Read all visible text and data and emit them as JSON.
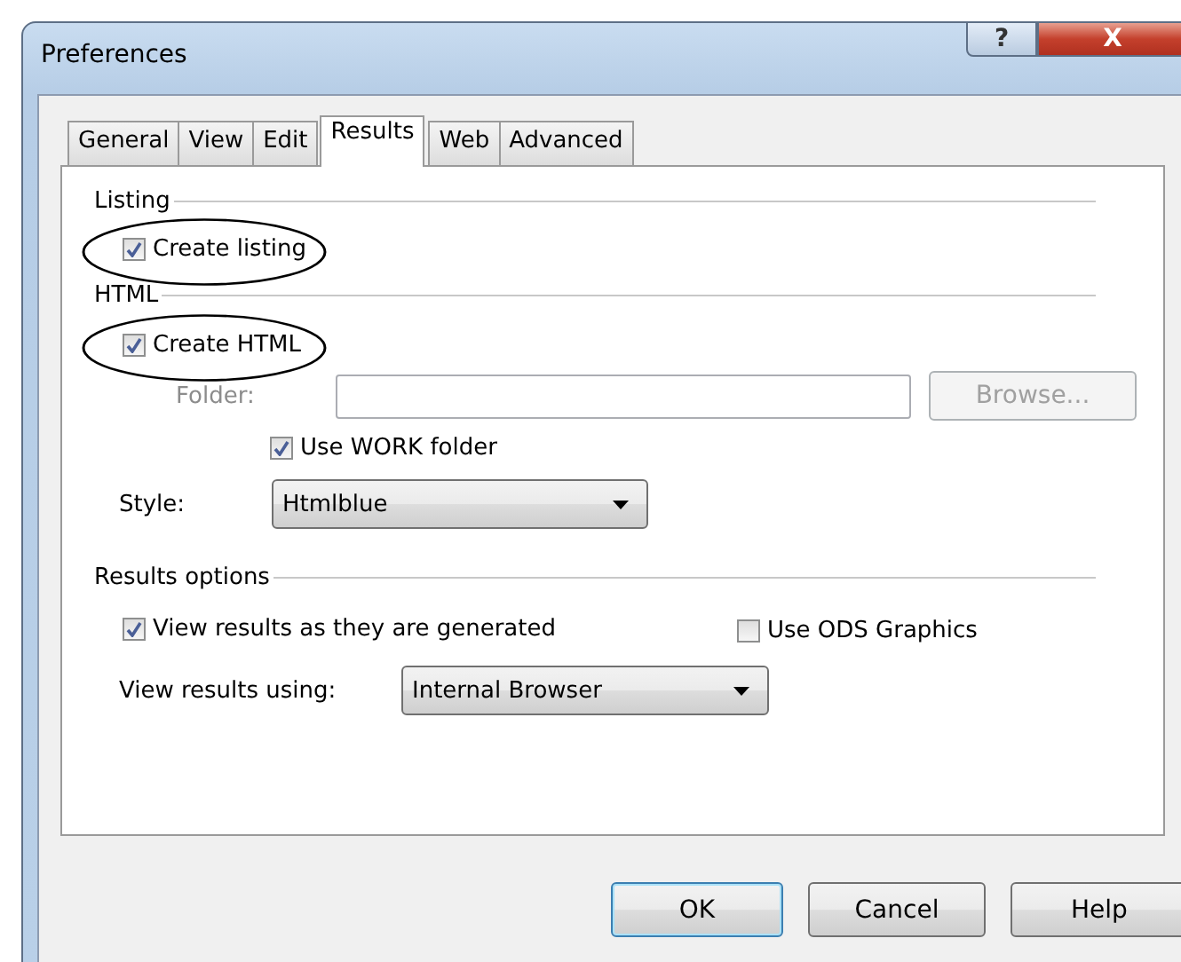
{
  "window": {
    "title": "Preferences",
    "help_button": "?",
    "close_button": "X"
  },
  "tabs": [
    {
      "label": "General",
      "selected": false
    },
    {
      "label": "View",
      "selected": false
    },
    {
      "label": "Edit",
      "selected": false
    },
    {
      "label": "Results",
      "selected": true
    },
    {
      "label": "Web",
      "selected": false
    },
    {
      "label": "Advanced",
      "selected": false
    }
  ],
  "listing": {
    "heading": "Listing",
    "create_listing": {
      "label": "Create listing",
      "checked": true,
      "circled": true
    }
  },
  "html": {
    "heading": "HTML",
    "create_html": {
      "label": "Create HTML",
      "checked": true,
      "circled": true
    },
    "folder": {
      "label": "Folder:",
      "disabled": true
    },
    "browse_button": {
      "label": "Browse...",
      "disabled": true
    },
    "use_work_folder": {
      "label": "Use WORK folder",
      "checked": true
    },
    "style": {
      "label": "Style:",
      "value": "Htmlblue"
    }
  },
  "results_options": {
    "heading": "Results options",
    "view_results": {
      "label": "View results as they are generated",
      "checked": true
    },
    "use_ods_graphics": {
      "label": "Use ODS Graphics",
      "checked": false
    },
    "view_using": {
      "label": "View results using:",
      "value": "Internal Browser"
    }
  },
  "buttons": [
    {
      "label": "OK",
      "default": true
    },
    {
      "label": "Cancel",
      "default": false
    },
    {
      "label": "Help",
      "default": false
    }
  ]
}
